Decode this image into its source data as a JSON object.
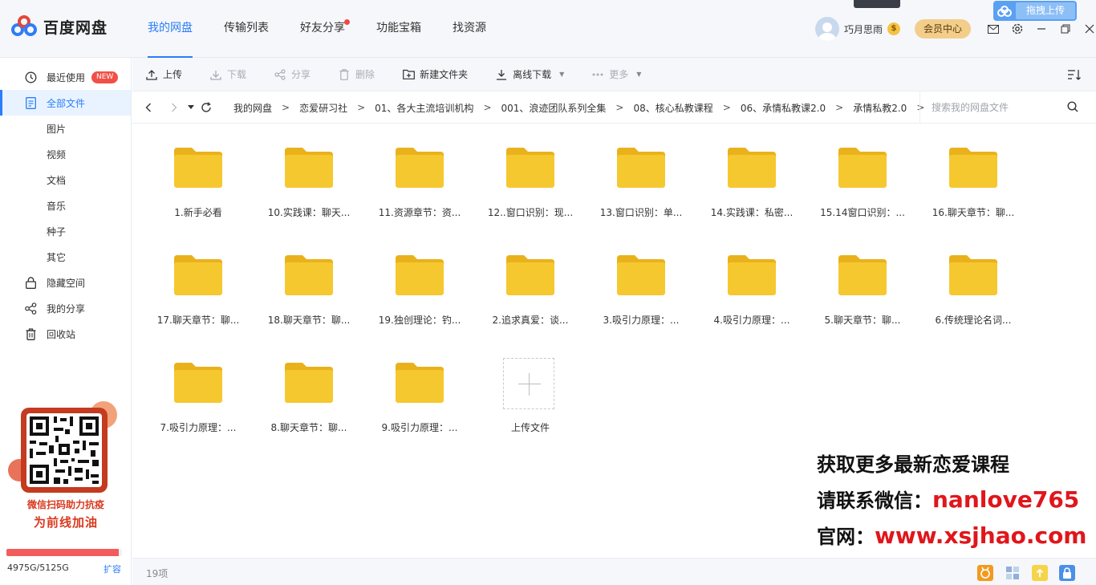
{
  "app": {
    "name": "百度网盘"
  },
  "topnav": [
    {
      "label": "我的网盘",
      "active": true
    },
    {
      "label": "传输列表",
      "active": false
    },
    {
      "label": "好友分享",
      "active": false,
      "dot": true
    },
    {
      "label": "功能宝箱",
      "active": false
    },
    {
      "label": "找资源",
      "active": false
    }
  ],
  "user": {
    "name": "巧月思雨",
    "vip_label": "会员中心",
    "drag_upload": "拖拽上传"
  },
  "sidebar": {
    "items": [
      {
        "label": "最近使用",
        "icon": "clock-icon",
        "badge": "NEW"
      },
      {
        "label": "全部文件",
        "icon": "file-icon",
        "active": true
      },
      {
        "label": "图片",
        "sub": true
      },
      {
        "label": "视频",
        "sub": true
      },
      {
        "label": "文档",
        "sub": true
      },
      {
        "label": "音乐",
        "sub": true
      },
      {
        "label": "种子",
        "sub": true
      },
      {
        "label": "其它",
        "sub": true
      },
      {
        "label": "隐藏空间",
        "icon": "lock-icon"
      },
      {
        "label": "我的分享",
        "icon": "share-icon"
      },
      {
        "label": "回收站",
        "icon": "trash-icon"
      }
    ],
    "promo": {
      "line1": "微信扫码助力抗疫",
      "line2": "为前线加油"
    },
    "quota": {
      "used_text": "4975G/5125G",
      "expand": "扩容",
      "fraction": 0.971
    }
  },
  "toolbar": {
    "upload": "上传",
    "download": "下载",
    "share": "分享",
    "delete": "删除",
    "new_folder": "新建文件夹",
    "offline_download": "离线下载",
    "more": "更多"
  },
  "breadcrumb": [
    "我的网盘",
    "恋爱研习社",
    "01、各大主流培训机构",
    "001、浪迹团队系列全集",
    "08、核心私教课程",
    "06、承情私教课2.0",
    "承情私教2.0"
  ],
  "search": {
    "placeholder": "搜索我的网盘文件"
  },
  "files": [
    "1.新手必看",
    "10.实践课：聊天...",
    "11.资源章节：资...",
    "12..窗口识别：现...",
    "13.窗口识别：单...",
    "14.实践课：私密...",
    "15.14窗口识别：...",
    "16.聊天章节：聊...",
    "17.聊天章节：聊...",
    "18.聊天章节：聊...",
    "19.独创理论：钓...",
    "2.追求真爱：谈...",
    "3.吸引力原理：...",
    "4.吸引力原理：...",
    "5.聊天章节：聊...",
    "6.传统理论名词...",
    "7.吸引力原理：...",
    "8.聊天章节：聊...",
    "9.吸引力原理：..."
  ],
  "upload_tile": {
    "label": "上传文件"
  },
  "watermark": {
    "line1": "获取更多最新恋爱课程",
    "line2_prefix": "请联系微信：",
    "line2_value": "nanlove765",
    "line3_prefix": "官网：",
    "line3_value": "www.xsjhao.com"
  },
  "status": {
    "count": "19项"
  },
  "colors": {
    "accent": "#2a7ef8",
    "folder": "#f6c830",
    "badge": "#f05048",
    "watermark_red": "#e0161b"
  }
}
